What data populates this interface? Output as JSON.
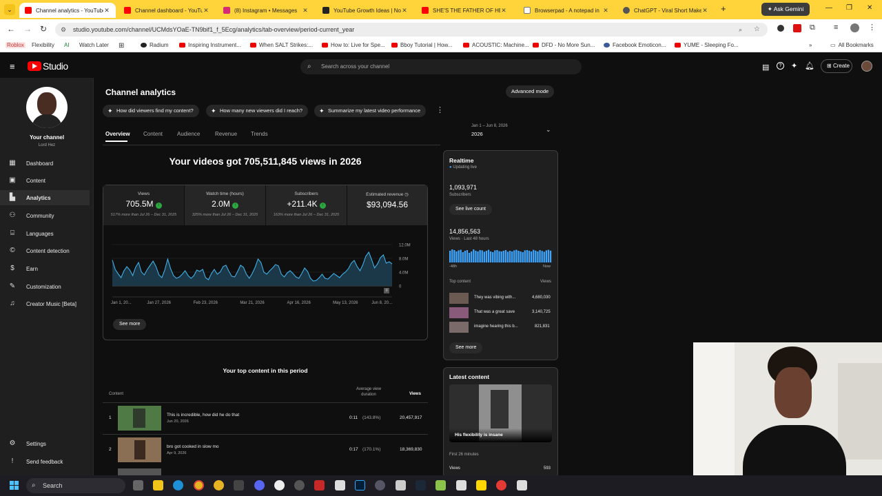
{
  "browser": {
    "tabs": [
      {
        "title": "Channel analytics - YouTube",
        "active": true
      },
      {
        "title": "Channel dashboard - YouTube"
      },
      {
        "title": "(8) Instagram • Messages"
      },
      {
        "title": "YouTube Growth Ideas | No"
      },
      {
        "title": "SHE'S THE FATHER OF HER"
      },
      {
        "title": "Browserpad - A notepad in"
      },
      {
        "title": "ChatGPT - Viral Short Make"
      }
    ],
    "new_tab": "+",
    "ask_gemini": "Ask Gemini",
    "url": "studio.youtube.com/channel/UCMdsYOaE-TN9bif1_f_5Ecg/analytics/tab-overview/period-current_year",
    "bookmarks": [
      "Roblox",
      "Flexibility",
      "AI",
      "Watch Later",
      "Radium",
      "Inspiring Instrument...",
      "When SALT Strikes:...",
      "How to: Live for Spe...",
      "Bboy Tutorial | How...",
      "ACOUSTIC: Machine...",
      "DFD - No More Sun...",
      "Facebook Emoticon...",
      "YUME - Sleeping Fo..."
    ],
    "all_bookmarks": "All Bookmarks"
  },
  "studio": {
    "logo": "Studio",
    "search_placeholder": "Search across your channel",
    "create": "Create"
  },
  "sidebar": {
    "channel_label": "Your channel",
    "channel_name": "Lord Hez",
    "items": [
      {
        "label": "Dashboard",
        "icon": "dashboard-icon"
      },
      {
        "label": "Content",
        "icon": "content-icon"
      },
      {
        "label": "Analytics",
        "icon": "analytics-icon",
        "active": true
      },
      {
        "label": "Community",
        "icon": "community-icon"
      },
      {
        "label": "Languages",
        "icon": "languages-icon"
      },
      {
        "label": "Content detection",
        "icon": "copyright-icon"
      },
      {
        "label": "Earn",
        "icon": "dollar-icon"
      },
      {
        "label": "Customization",
        "icon": "customization-icon"
      },
      {
        "label": "Creator Music [Beta]",
        "icon": "music-icon"
      }
    ],
    "settings": "Settings",
    "feedback": "Send feedback"
  },
  "main": {
    "title": "Channel analytics",
    "advanced": "Advanced mode",
    "chips": [
      "How did viewers find my content?",
      "How many new viewers did I reach?",
      "Summarize my latest video performance"
    ],
    "tabs": [
      "Overview",
      "Content",
      "Audience",
      "Revenue",
      "Trends"
    ],
    "date_range": "Jan 1 – Jun 8, 2026",
    "date_year": "2026",
    "headline": "Your videos got 705,511,845 views in 2026",
    "metrics": [
      {
        "label": "Views",
        "value": "705.5M",
        "sub": "517% more than Jul 26 – Dec 31, 2025",
        "up": true
      },
      {
        "label": "Watch time (hours)",
        "value": "2.0M",
        "sub": "325% more than Jul 26 – Dec 31, 2025",
        "up": true
      },
      {
        "label": "Subscribers",
        "value": "+211.4K",
        "sub": "163% more than Jul 26 – Dec 31, 2025",
        "up": true
      },
      {
        "label": "Estimated revenue",
        "value": "$93,094.56",
        "sub": ""
      }
    ],
    "see_more": "See more",
    "top_content_title": "Your top content in this period",
    "table_headers": {
      "content": "Content",
      "avg": "Average view duration",
      "views": "Views"
    },
    "rows": [
      {
        "rank": "1",
        "title": "This is incredible, how did he do that",
        "date": "Jun 20, 2026",
        "avg": "0:11",
        "pct": "(143.8%)",
        "views": "20,457,917"
      },
      {
        "rank": "2",
        "title": "bro got cooked in slow mo",
        "date": "Apr 9, 2026",
        "avg": "0:17",
        "pct": "(170.1%)",
        "views": "18,369,830"
      }
    ]
  },
  "chart_data": {
    "type": "area",
    "x_ticks": [
      "Jan 1, 20...",
      "Jan 27, 2026",
      "Feb 23, 2026",
      "Mar 21, 2026",
      "Apr 16, 2026",
      "May 13, 2026",
      "Jun 8, 20..."
    ],
    "y_ticks": [
      "12.0M",
      "8.0M",
      "4.0M",
      "0"
    ],
    "ylim": [
      0,
      12000000
    ],
    "values": [
      7.5,
      4.8,
      3.5,
      2.4,
      4.4,
      5.6,
      4.6,
      3.0,
      5.4,
      6.8,
      4.0,
      3.2,
      4.8,
      6.0,
      7.2,
      5.6,
      3.2,
      2.4,
      4.6,
      7.8,
      5.0,
      3.0,
      2.2,
      2.6,
      3.4,
      4.4,
      3.0,
      2.2,
      3.0,
      4.6,
      4.2,
      4.8,
      2.4,
      1.8,
      3.6,
      4.8,
      3.4,
      4.0,
      5.6,
      6.0,
      4.2,
      2.8,
      2.6,
      4.2,
      6.0,
      5.4,
      3.4,
      2.2,
      3.6,
      5.4,
      7.8,
      6.8,
      4.0,
      3.4,
      4.4,
      5.2,
      6.2,
      5.8,
      3.4,
      2.6,
      3.8,
      4.4,
      3.6,
      2.6,
      2.2,
      3.6,
      5.2,
      4.2,
      2.2,
      1.4,
      1.6,
      2.4,
      3.4,
      2.2,
      2.0,
      2.8,
      3.6,
      3.0,
      2.4,
      3.4,
      4.0,
      5.0,
      6.6,
      7.4,
      5.6,
      4.4,
      6.2,
      8.6,
      9.8,
      7.6,
      5.2,
      6.4,
      8.2,
      9.0,
      6.6,
      7.0,
      6.4
    ]
  },
  "realtime": {
    "title": "Realtime",
    "updating": "Updating live",
    "subs_value": "1,093,971",
    "subs_label": "Subscribers",
    "see_live": "See live count",
    "views_value": "14,856,563",
    "views_label": "Views · Last 48 hours",
    "axis_left": "-48h",
    "axis_right": "Now",
    "bars": [
      0.85,
      0.95,
      0.9,
      0.8,
      0.88,
      0.92,
      0.75,
      0.85,
      0.9,
      0.7,
      0.8,
      0.95,
      0.85,
      0.8,
      0.9,
      0.88,
      0.78,
      0.85,
      0.92,
      0.8,
      0.75,
      0.88,
      0.9,
      0.82,
      0.8,
      0.85,
      0.9,
      0.78,
      0.85,
      0.8,
      0.88,
      0.92,
      0.85,
      0.8,
      0.75,
      0.88,
      0.9,
      0.85,
      0.8,
      0.92,
      0.86,
      0.8,
      0.9,
      0.84,
      0.78,
      0.88,
      0.92,
      0.86
    ],
    "top_label": "Top content",
    "views_col": "Views",
    "top": [
      {
        "title": "They was vibing with...",
        "views": "4,680,030"
      },
      {
        "title": "That was a great save",
        "views": "3,140,725"
      },
      {
        "title": "imagine hearing this b...",
        "views": "821,831"
      }
    ],
    "see_more": "See more"
  },
  "latest": {
    "title": "Latest content",
    "video_title": "His flexibility is insane",
    "first": "First 26 minutes",
    "views_label": "Views",
    "views_value": "593"
  },
  "taskbar": {
    "search": "Search"
  }
}
